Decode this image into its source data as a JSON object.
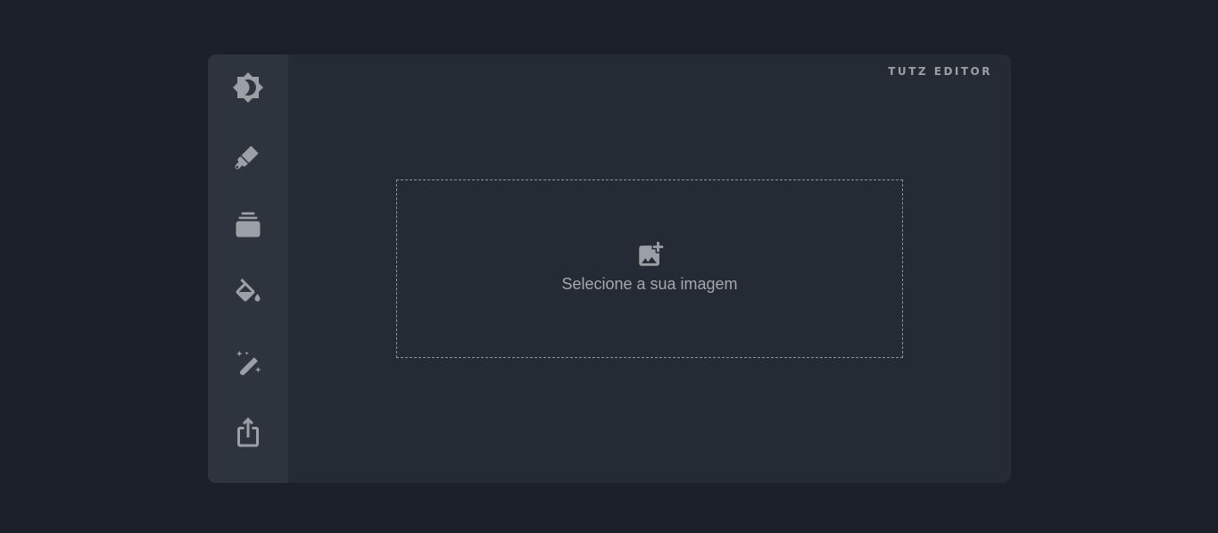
{
  "app": {
    "brand": "TUTZ EDITOR"
  },
  "sidebar": {
    "items": [
      {
        "id": "brightness",
        "icon": "brightness-icon"
      },
      {
        "id": "paint-brush",
        "icon": "paint-brush-icon"
      },
      {
        "id": "layers",
        "icon": "layers-icon"
      },
      {
        "id": "fill",
        "icon": "paint-bucket-icon"
      },
      {
        "id": "effects",
        "icon": "magic-wand-icon"
      },
      {
        "id": "export",
        "icon": "share-icon"
      }
    ]
  },
  "dropzone": {
    "label": "Selecione a sua imagem",
    "icon": "add-image-icon"
  },
  "colors": {
    "page_background": "#1a1f29",
    "panel_background": "#252b35",
    "sidebar_background": "#2d343e",
    "icon": "#9aa0a6",
    "text": "#a3a8ae"
  }
}
